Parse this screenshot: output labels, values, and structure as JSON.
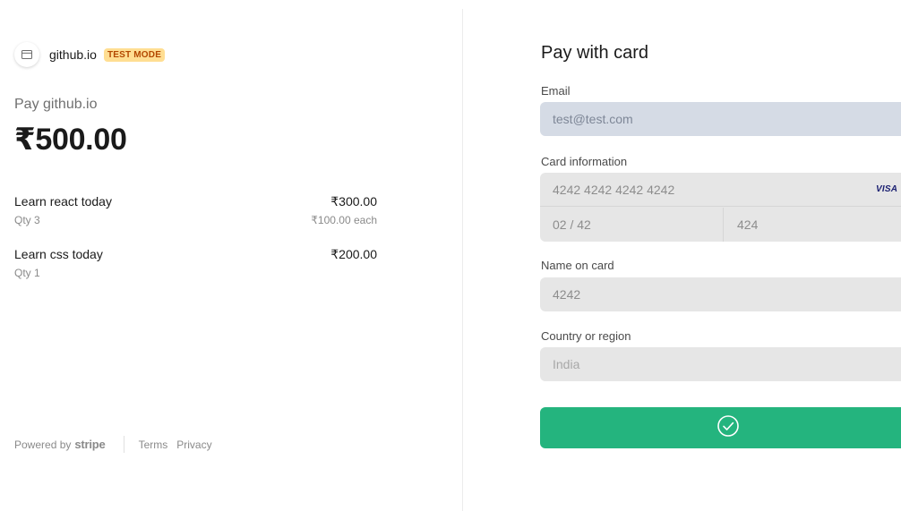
{
  "merchant": {
    "name": "github.io",
    "badge": "TEST MODE"
  },
  "summary": {
    "pay_label": "Pay github.io",
    "total": "₹500.00"
  },
  "line_items": [
    {
      "name": "Learn react today",
      "price": "₹300.00",
      "qty": "Qty 3",
      "unit_price": "₹100.00 each"
    },
    {
      "name": "Learn css today",
      "price": "₹200.00",
      "qty": "Qty 1",
      "unit_price": ""
    }
  ],
  "footer": {
    "powered_by": "Powered by",
    "brand": "stripe",
    "terms": "Terms",
    "privacy": "Privacy"
  },
  "form": {
    "title": "Pay with card",
    "email_label": "Email",
    "email_value": "test@test.com",
    "card_label": "Card information",
    "card_number": "4242 4242 4242 4242",
    "card_brand": "VISA",
    "expiry": "02 / 42",
    "cvc": "424",
    "name_label": "Name on card",
    "name_value": "4242",
    "country_label": "Country or region",
    "country_value": "India"
  },
  "colors": {
    "pay_button": "#24b47e",
    "test_badge_bg": "#ffde92",
    "test_badge_text": "#b34800",
    "email_field_bg": "#d5dbe5",
    "field_bg": "#e6e6e6"
  },
  "icons": {
    "merchant": "store-icon",
    "pay_button": "check-circle-icon",
    "cvc": "card-cvc-icon"
  }
}
